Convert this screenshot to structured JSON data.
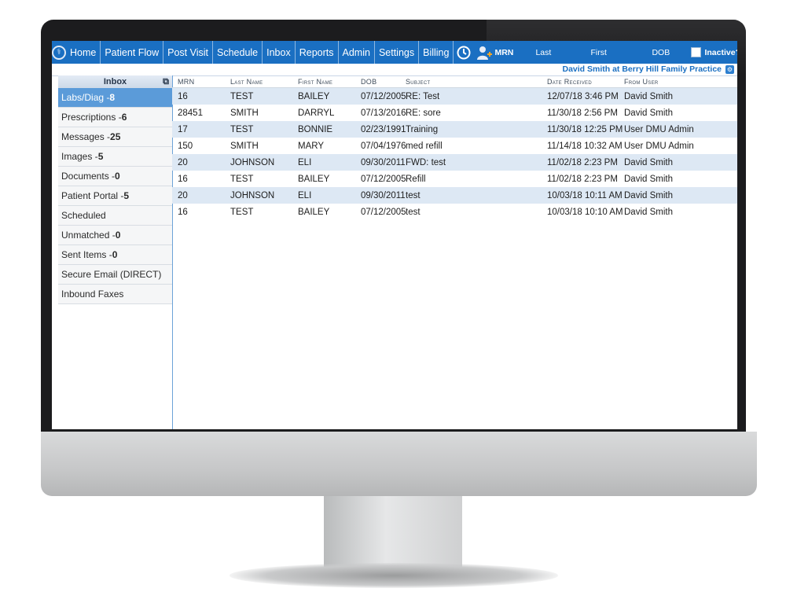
{
  "nav": {
    "items": [
      "Home",
      "Patient Flow",
      "Post Visit",
      "Schedule",
      "Inbox",
      "Reports",
      "Admin",
      "Settings",
      "Billing"
    ],
    "search": {
      "mrn": "MRN",
      "last": "Last",
      "first": "First",
      "dob": "DOB",
      "inactive": "Inactive?"
    }
  },
  "practice_label": "David Smith at Berry Hill Family Practice",
  "sidebar": {
    "title": "Inbox",
    "items": [
      {
        "label": "Labs/Diag - ",
        "count": "8"
      },
      {
        "label": "Prescriptions - ",
        "count": "6"
      },
      {
        "label": "Messages - ",
        "count": "25"
      },
      {
        "label": "Images - ",
        "count": "5"
      },
      {
        "label": "Documents - ",
        "count": "0"
      },
      {
        "label": "Patient Portal - ",
        "count": "5"
      },
      {
        "label": "Scheduled",
        "count": ""
      },
      {
        "label": "Unmatched - ",
        "count": "0"
      },
      {
        "label": "Sent Items - ",
        "count": "0"
      },
      {
        "label": "Secure Email (DIRECT)",
        "count": ""
      },
      {
        "label": "Inbound Faxes",
        "count": ""
      }
    ]
  },
  "table": {
    "headers": {
      "mrn": "MRN",
      "last": "Last Name",
      "first": "First Name",
      "dob": "DOB",
      "subject": "Subject",
      "date": "Date Received",
      "from": "From User"
    },
    "rows": [
      {
        "mrn": "16",
        "last": "TEST",
        "first": "BAILEY",
        "dob": "07/12/2005",
        "subject": "RE: Test",
        "date": "12/07/18 3:46 PM",
        "from": "David Smith"
      },
      {
        "mrn": "28451",
        "last": "SMITH",
        "first": "DARRYL",
        "dob": "07/13/2016",
        "subject": "RE: sore",
        "date": "11/30/18 2:56 PM",
        "from": "David Smith"
      },
      {
        "mrn": "17",
        "last": "TEST",
        "first": "BONNIE",
        "dob": "02/23/1991",
        "subject": "Training",
        "date": "11/30/18 12:25 PM",
        "from": "User DMU Admin"
      },
      {
        "mrn": "150",
        "last": "SMITH",
        "first": "MARY",
        "dob": "07/04/1976",
        "subject": "med refill",
        "date": "11/14/18 10:32 AM",
        "from": "User DMU Admin"
      },
      {
        "mrn": "20",
        "last": "JOHNSON",
        "first": "ELI",
        "dob": "09/30/2011",
        "subject": "FWD: test",
        "date": "11/02/18 2:23 PM",
        "from": "David Smith"
      },
      {
        "mrn": "16",
        "last": "TEST",
        "first": "BAILEY",
        "dob": "07/12/2005",
        "subject": "Refill",
        "date": "11/02/18 2:23 PM",
        "from": "David Smith"
      },
      {
        "mrn": "20",
        "last": "JOHNSON",
        "first": "ELI",
        "dob": "09/30/2011",
        "subject": "test",
        "date": "10/03/18 10:11 AM",
        "from": "David Smith"
      },
      {
        "mrn": "16",
        "last": "TEST",
        "first": "BAILEY",
        "dob": "07/12/2005",
        "subject": "test",
        "date": "10/03/18 10:10 AM",
        "from": "David Smith"
      }
    ]
  }
}
